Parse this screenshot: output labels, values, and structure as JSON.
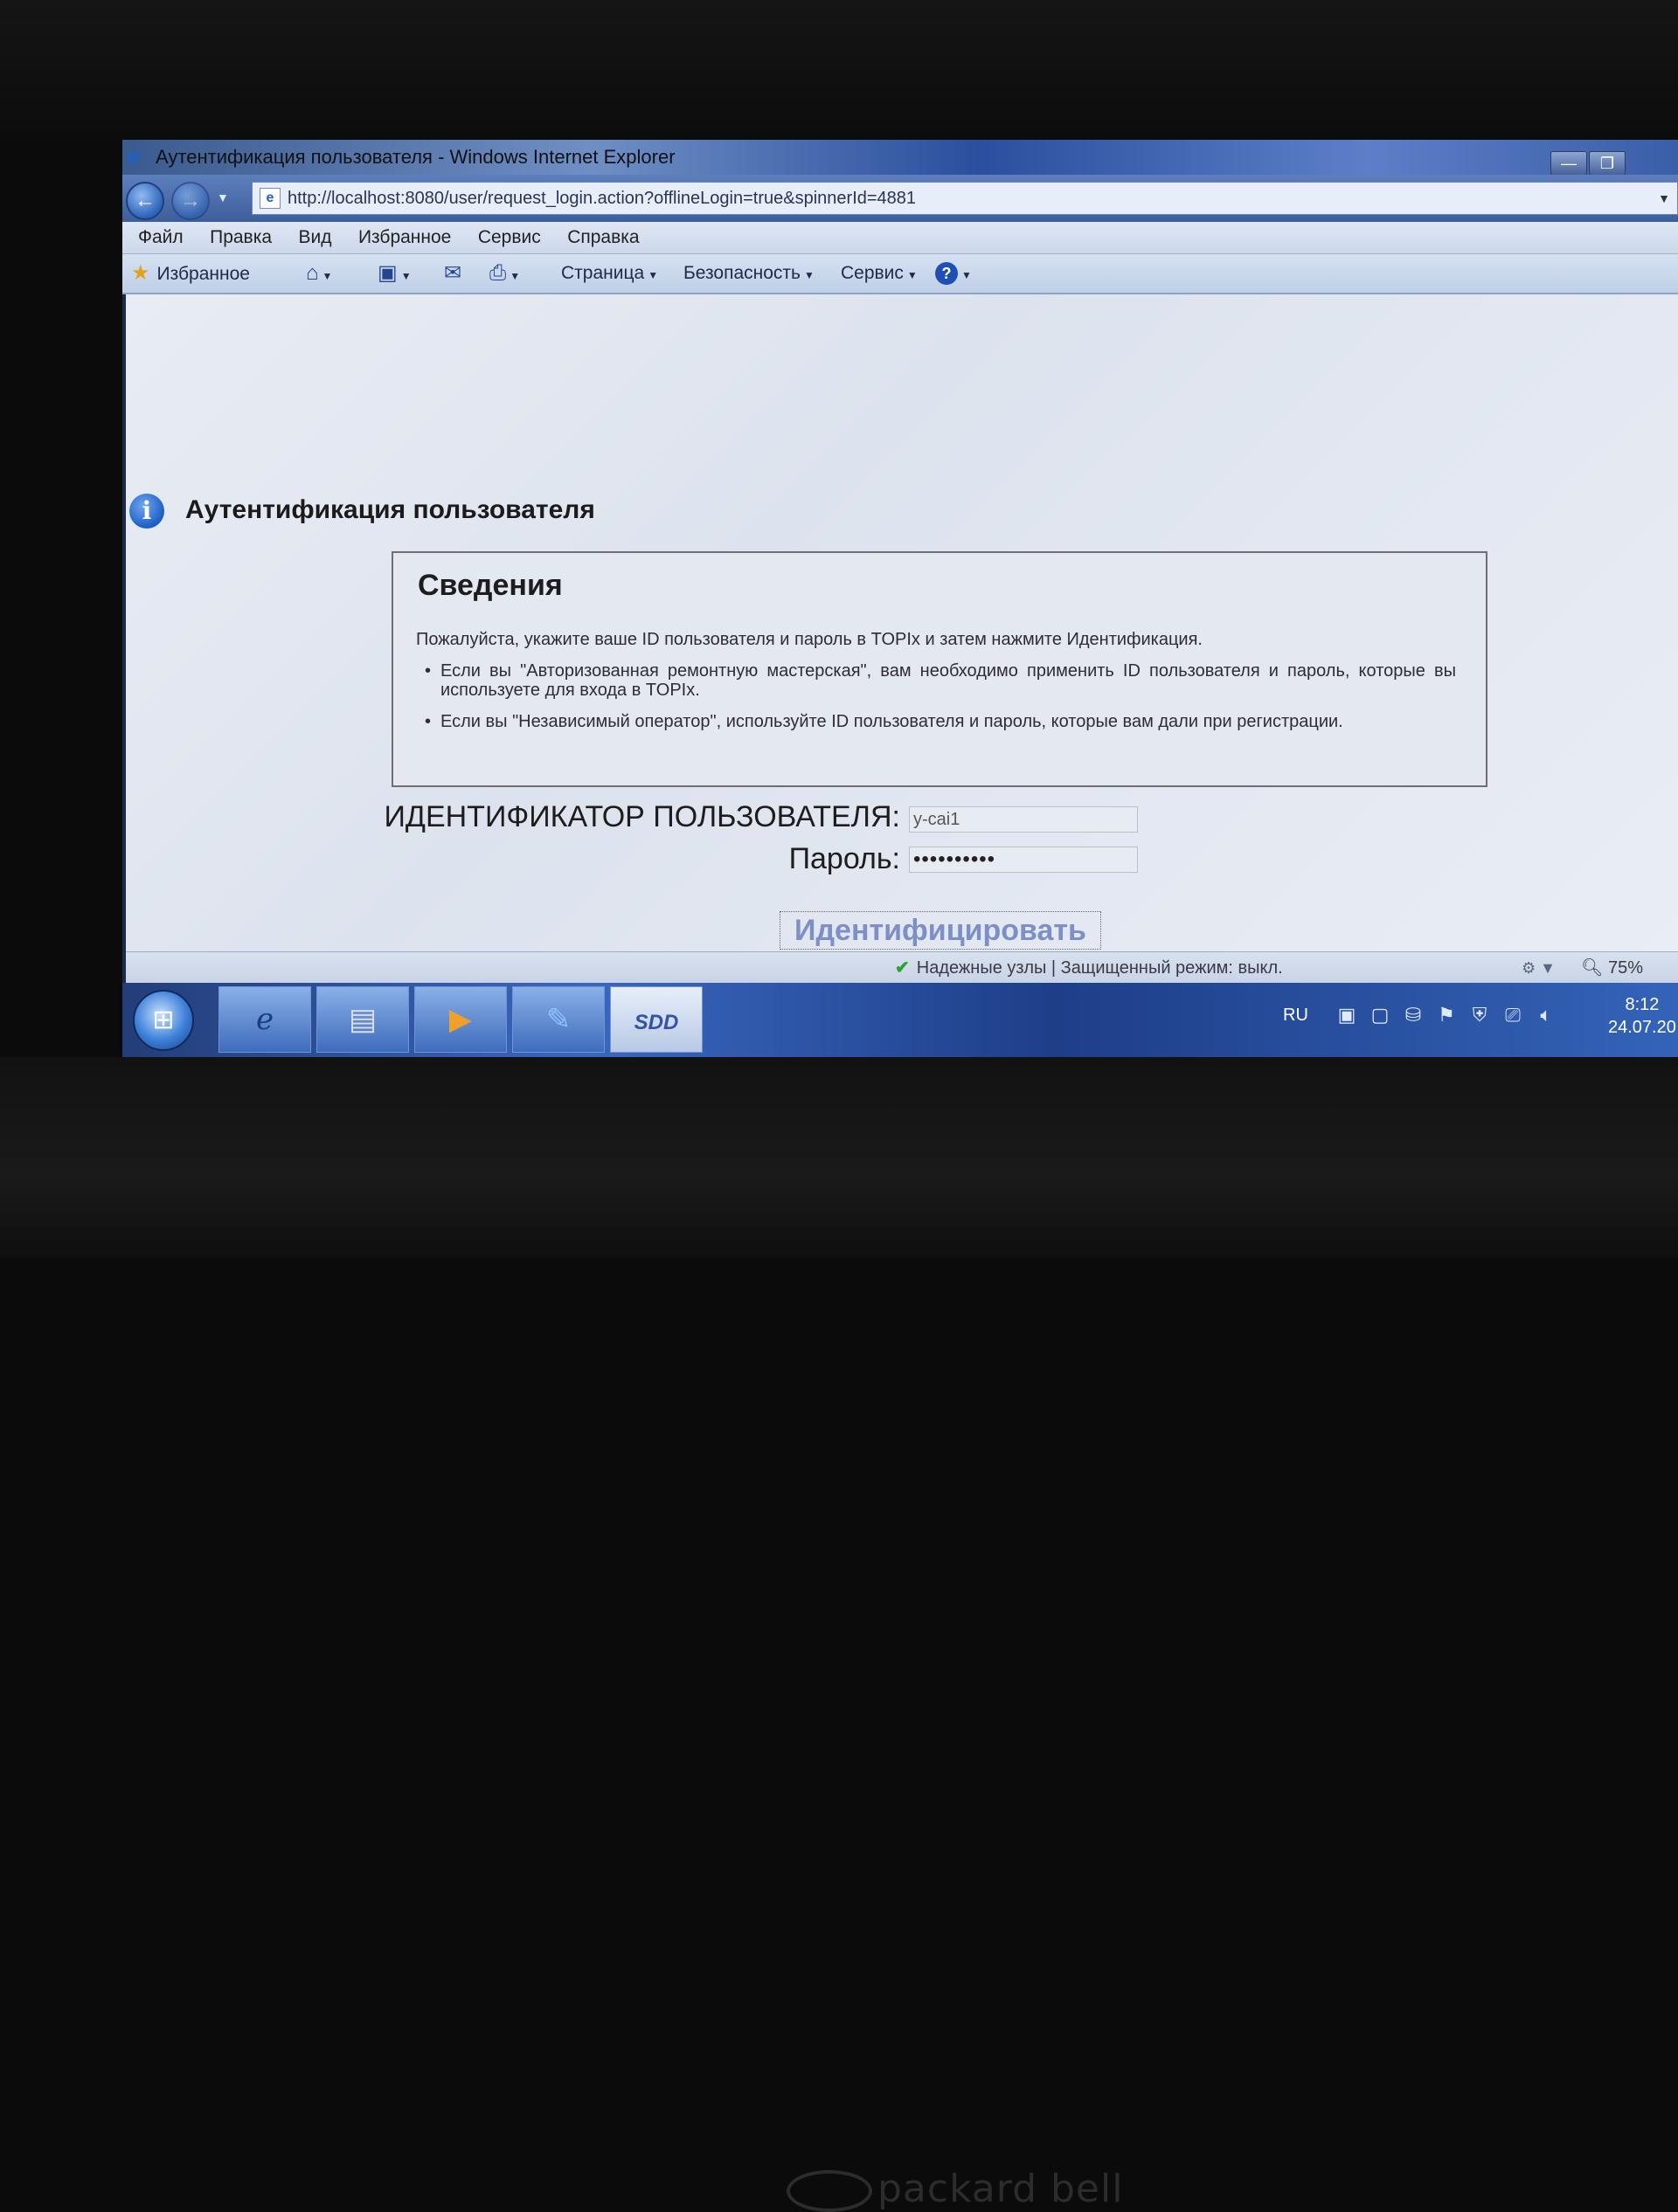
{
  "window": {
    "title": "Аутентификация пользователя - Windows Internet Explorer",
    "minimize_icon": "minimize-icon",
    "restore_icon": "restore-icon"
  },
  "address_bar": {
    "url": "http://localhost:8080/user/request_login.action?offlineLogin=true&spinnerId=4881"
  },
  "menu": [
    "Файл",
    "Правка",
    "Вид",
    "Избранное",
    "Сервис",
    "Справка"
  ],
  "command_bar": {
    "favorites": "Избранное",
    "page": "Страница",
    "safety": "Безопасность",
    "tools": "Сервис"
  },
  "page": {
    "title": "Аутентификация пользователя",
    "info_box": {
      "heading": "Сведения",
      "intro": "Пожалуйста, укажите ваше ID пользователя и пароль в TOPIx и затем нажмите Идентификация.",
      "bullets": [
        "Если вы \"Авторизованная ремонтную мастерская\", вам необходимо применить ID пользователя и пароль, которые вы используете для входа в TOPIx.",
        "Если вы \"Независимый оператор\", используйте ID пользователя и пароль, которые вам дали при регистрации."
      ]
    },
    "form": {
      "user_label": "ИДЕНТИФИКАТОР ПОЛЬЗОВАТЕЛЯ:",
      "user_value": "y-cai1",
      "password_label": "Пароль:",
      "password_value": "••••••••••",
      "submit": "Идентифицировать"
    }
  },
  "status_bar": {
    "status": "Надежные узлы | Защищенный режим: выкл.",
    "zoom": "75%"
  },
  "taskbar": {
    "items": [
      "start-button",
      "internet-explorer",
      "file-explorer",
      "media-player",
      "notepad",
      "SDD"
    ],
    "sdd_label": "SDD",
    "language": "RU",
    "time": "8:12",
    "date": "24.07.20"
  },
  "device": {
    "brand": "packard bell"
  },
  "colors": {
    "accent": "#1d5ec4",
    "button_text": "#7d8fc4",
    "status_ok": "#2aa130"
  }
}
